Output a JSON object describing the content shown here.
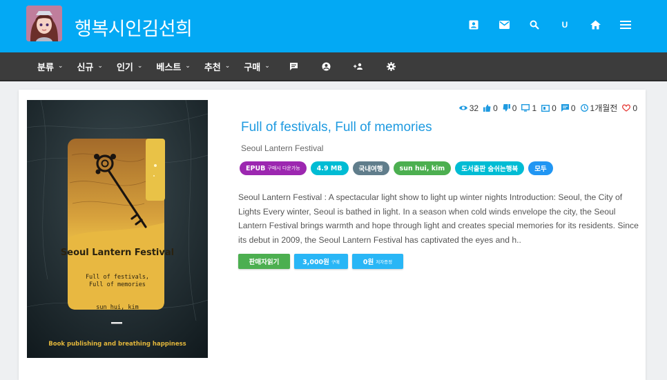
{
  "site": {
    "title": "행복시인김선희",
    "logo_icon": "avatar-portrait",
    "header_icons": [
      "contact-icon",
      "mail-icon",
      "search-icon",
      "user-icon",
      "home-icon",
      "menu-icon"
    ],
    "header_letter": "U",
    "colors": {
      "header": "#03a9f4",
      "nav": "#3c3c3c",
      "title": "#1e9ae0"
    }
  },
  "nav": {
    "items": [
      {
        "label": "분류"
      },
      {
        "label": "신규"
      },
      {
        "label": "인기"
      },
      {
        "label": "베스트"
      },
      {
        "label": "추천"
      },
      {
        "label": "구매"
      }
    ],
    "icons": [
      "chat-icon",
      "account-circle-icon",
      "group-add-icon",
      "settings-icon"
    ]
  },
  "book": {
    "stats": {
      "views": "32",
      "likes": "0",
      "dislikes": "0",
      "screens": "1",
      "cards": "0",
      "comments": "0",
      "time": "1개월전",
      "hearts": "0"
    },
    "title": "Full of festivals, Full of memories",
    "subtitle": "Seoul Lantern Festival",
    "badges": [
      {
        "label": "EPUB",
        "small": "구매시 다운가능",
        "color": "#9c27b0"
      },
      {
        "label": "4.9 MB",
        "small": "",
        "color": "#00bcd4"
      },
      {
        "label": "국내여행",
        "small": "",
        "color": "#607d8b"
      },
      {
        "label": "sun hui, kim",
        "small": "",
        "color": "#4caf50"
      },
      {
        "label": "도서출판 숨쉬는행복",
        "small": "",
        "color": "#00bcd4"
      },
      {
        "label": "모두",
        "small": "",
        "color": "#2196f3"
      }
    ],
    "description": "Seoul Lantern Festival : A spectacular light show to light up winter nights Introduction: Seoul, the City of Lights Every winter, Seoul is bathed in light. In a season when cold winds envelope the city, the Seoul Lantern Festival brings warmth and hope through light and creates special memories for its residents. Since its debut in 2009, the Seoul Lantern Festival has captivated the eyes and h..",
    "actions": [
      {
        "label": "판매자읽기",
        "small": "",
        "color": "#4caf50"
      },
      {
        "label": "3,000원",
        "small": "구매",
        "color": "#29b6f6"
      },
      {
        "label": "0원",
        "small": "저자증정",
        "color": "#29b6f6"
      }
    ],
    "cover": {
      "title": "Seoul Lantern Festival",
      "subtitle": "Full of festivals,\nFull of memories",
      "author": "sun hui, kim",
      "footer": "Book publishing and breathing happiness"
    }
  }
}
